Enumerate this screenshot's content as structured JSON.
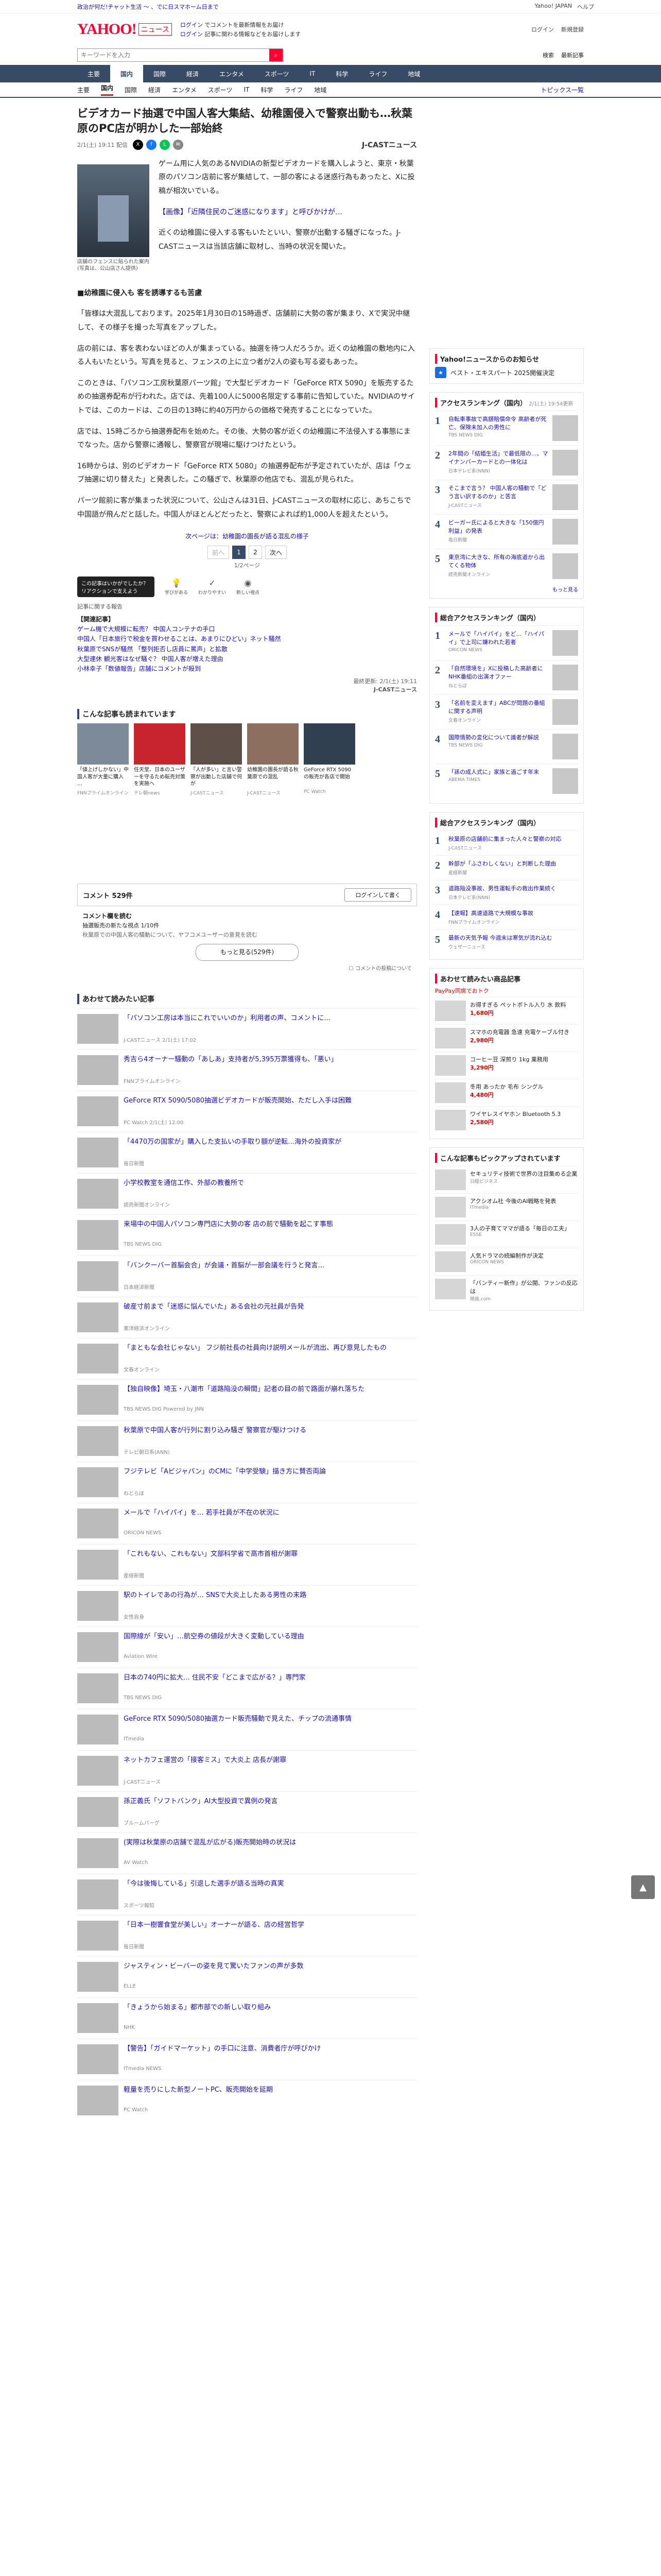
{
  "topbar": {
    "promo": "政治が何だ!チャット生活 ～ 、でに日スマホーム日まで",
    "links": [
      "Yahoo! JAPAN",
      "ヘルプ"
    ]
  },
  "header": {
    "logo": "YAHOO!",
    "logo_sub": "ニュース",
    "promo_1": "ログイン",
    "promo_1b": "でコメントを最新情報をお届け",
    "promo_2": "ログイン",
    "promo_2b": "記事に関わる情報などをお届けします",
    "right": [
      "ログイン",
      "新規登録"
    ]
  },
  "search": {
    "placeholder": "キーワードを入力",
    "right": [
      "検索",
      "最新記事"
    ]
  },
  "nav": [
    "主要",
    "国内",
    "国際",
    "経済",
    "エンタメ",
    "スポーツ",
    "IT",
    "科学",
    "ライフ",
    "地域"
  ],
  "subnav": [
    "主要",
    "国内",
    "国際",
    "経済",
    "エンタメ",
    "スポーツ",
    "IT",
    "科学",
    "ライフ",
    "地域"
  ],
  "subnav_topics": "トピックス一覧",
  "article": {
    "title": "ビデオカード抽選で中国人客大集結、幼稚園侵入で警察出動も…秋葉原のPC店が明かした一部始終",
    "date": "2/1(土) 19:11 配信",
    "source": "J-CASTニュース",
    "image_caption": "店舗のフェンスに貼られた案内(写真は、公山店さん提供)",
    "p1": "ゲーム用に人気のあるNVIDIAの新型ビデオカードを購入しようと、東京・秋葉原のパソコン店前に客が集結して、一部の客による迷惑行為もあったと、Xに投稿が相次いでいる。",
    "p2_link": "【画像】「近隣住民のご迷惑になります」と呼びかけが…",
    "p3": "近くの幼稚園に侵入する客もいたといい、警察が出動する騒ぎになった。J-CASTニュースは当該店舗に取材し、当時の状況を聞いた。",
    "sub1": "■幼稚園に侵入も 客を誘導するも苦慮",
    "p4": "「皆様は大混乱しております。2025年1月30日の15時過ぎ、店舗前に大勢の客が集まり、Xで実況中継して、その様子を撮った写真をアップした。",
    "p5": "店の前には、客を表わないほどの人が集まっている。抽選を待つ人だろうか。近くの幼稚園の敷地内に入る人もいたという。写真を見ると、フェンスの上に立つ者が2人の姿も写る姿もあった。",
    "p6": "このときは、「パソコン工房秋葉原パーツ館」で大型ビデオカード「GeForce RTX 5090」を販売するための抽選券配布が行われた。店では、先着100人に5000名限定する事前に告知していた。NVIDIAのサイトでは、このカードは、この日の13時に約40万円からの価格で発売することになっていた。",
    "p7": "店では、15時ごろから抽選券配布を始めた。その後、大勢の客が近くの幼稚園に不法侵入する事態にまでなった。店から警察に通報し、警察官が現場に駆けつけたという。",
    "p8": "16時からは、別のビデオカード「GeForce RTX 5080」の抽選券配布が予定されていたが、店は「ウェブ抽選に切り替えた」と発表した。この騒ぎで、秋葉原の他店でも、混乱が見られた。",
    "p9": "パーツ館前に客が集まった状況について、公山さんは31日、J-CASTニュースの取材に応じ、あちこちで中国語が飛んだと話した。中国人がほとんどだったと、警察によれば約1,000人を超えたという。",
    "continue": "次ページは：幼稚園の園長が語る混乱の様子"
  },
  "pager": {
    "prev": "前へ",
    "pages": [
      "1",
      "2"
    ],
    "next": "次へ",
    "count": "1/2ページ"
  },
  "reactions": {
    "prompt": "この記事はいかがでしたか？リアクションで支えよう",
    "buttons": [
      "学びがある",
      "わかりやすい",
      "新しい視点"
    ]
  },
  "related": {
    "label": "記事に関する報告",
    "heading": "【関連記事】",
    "items": [
      "ゲーム機で大規模に転売？ 中国人コンテナの手口",
      "中国人「日本旅行で税金を買わせることは、あまりにひどい」ネット騒然",
      "秋葉原でSNSが騒然 「整列拒否し店員に罵声」と拡散",
      "大型連休 観光客はなぜ騒ぐ？ 中国人客が増えた理由",
      "小林幸子「数値報告」店舗にコメントが殺到"
    ],
    "copyright": "最終更新: 2/1(土) 19:11",
    "copyright_source": "J-CASTニュース"
  },
  "reading_section": {
    "title": "こんな記事も読まれています",
    "items": [
      {
        "t": "「値上げしかない」中国人客が大量に購入 ...",
        "s": "FNNプライムオンライン"
      },
      {
        "t": "任天堂、日本のユーザーを守るため転売対策を実施へ",
        "s": "テレ朝news"
      },
      {
        "t": "「人が多い」と言い警察が出動した店舗で何が",
        "s": "J-CASTニュース"
      },
      {
        "t": "幼稚園の園長が語る秋葉原での混乱",
        "s": "J-CASTニュース"
      },
      {
        "t": "GeForce RTX 5090の販売が各店で開始",
        "s": "PC Watch"
      }
    ]
  },
  "comments": {
    "label": "コメント 529件",
    "write": "ログインして書く",
    "block_title": "コメント欄を読む",
    "block_sub": "抽選販売の新たな視点 1/10件",
    "hint": "秋葉原での中国人客の騒動について、ヤフコメユーザーの意見を読む",
    "more": "もっと見る(529件)",
    "rule": "コメントの投稿について"
  },
  "recommended": {
    "title": "あわせて読みたい記事",
    "items": [
      {
        "t": "「パソコン工房は本当にこれでいいのか」利用者の声、コメントに...",
        "s": "J-CASTニュース  2/1(土) 17:02"
      },
      {
        "t": "秀吉ら4オーナー騒動の「あしあ」支持者が5,395万票獲得も、「悪い」",
        "s": "FNNプライムオンライン"
      },
      {
        "t": "GeForce RTX 5090/5080抽選ビデオカードが販売開始、ただし入手は困難",
        "s": "PC Watch  2/1(土) 12:00"
      },
      {
        "t": "「4470万の国家が」購入した支払いの手取り額が逆転…海外の投資家が",
        "s": "毎日新聞"
      },
      {
        "t": "小学校教室を通信工作、外部の教養所で",
        "s": "読売新聞オンライン"
      },
      {
        "t": "来場中の中国人パソコン専門店に大勢の客 店の前で騒動を起こす事態",
        "s": "TBS NEWS DIG"
      },
      {
        "t": "「バンクーバー首脳会合」が会議・首脳が一部会議を行うと発言…",
        "s": "日本経済新聞"
      },
      {
        "t": "破産寸前まで「迷惑に悩んでいた」ある会社の元社員が告発",
        "s": "東洋経済オンライン"
      },
      {
        "t": "「まともな会社じゃない」 フジ前社長の社員向け説明メールが流出、再び意見したもの",
        "s": "文春オンライン"
      },
      {
        "t": "【独自映像】埼玉・八潮市「道路陥没の瞬間」記者の目の前で路面が崩れ落ちた",
        "s": "TBS NEWS DIG Powered by JNN"
      },
      {
        "t": "秋葉原で中国人客が行列に割り込み騒ぎ 警察官が駆けつける",
        "s": "テレビ朝日系(ANN)"
      },
      {
        "t": "フジテレビ「Aビジャパン」のCMに「中学受験」描き方に賛否両論",
        "s": "ねとらぼ"
      },
      {
        "t": "メールで「ハイパイ」を… 若手社員が不在の状況に",
        "s": "ORICON NEWS"
      },
      {
        "t": "「これもない、これもない」文部科学省で高市首相が謝罪",
        "s": "産経新聞"
      },
      {
        "t": "駅のトイレであの行為が… SNSで大炎上したある男性の末路",
        "s": "女性自身"
      },
      {
        "t": "国際線が「安い」…航空券の値段が大きく変動している理由",
        "s": "Aviation Wire"
      },
      {
        "t": "日本の740円に拡大… 住民不安「どこまで広がる？」専門家",
        "s": "TBS NEWS DIG"
      },
      {
        "t": "GeForce RTX 5090/5080抽選カード販売騒動で見えた、チップの流通事情",
        "s": "ITmedia"
      },
      {
        "t": "ネットカフェ運営の「接客ミス」で大炎上 店長が謝罪",
        "s": "J-CASTニュース"
      },
      {
        "t": "孫正義氏「ソフトバンク」AI大型投資で異例の発言",
        "s": "ブルームバーグ"
      },
      {
        "t": "(実際は秋葉原の店舗で混乱が広がる)販売開始時の状況は",
        "s": "AV Watch"
      },
      {
        "t": "「今は後悔している」引退した選手が語る当時の真実",
        "s": "スポーツ報知"
      },
      {
        "t": "「日本一樹響食堂が美しい」オーナーが語る、店の経営哲学",
        "s": "毎日新聞"
      },
      {
        "t": "ジャスティン・ビーバーの姿を見て驚いたファンの声が多数",
        "s": "ELLE"
      },
      {
        "t": "「きょうから始まる」都市部での新しい取り組み",
        "s": "NHK"
      },
      {
        "t": "【警告】「ガイドマーケット」の手口に注意、消費者庁が呼びかけ",
        "s": "ITmedia NEWS"
      },
      {
        "t": "軽量を売りにした新型ノートPC、販売開始を延期",
        "s": "PC Watch"
      }
    ]
  },
  "side": {
    "banner_title": "Yahoo!ニュースからのお知らせ",
    "banner_text": "ベスト・エキスパート 2025開催決定",
    "rank1_title": "アクセスランキング（国内）",
    "rank1_sub": "2/1(土) 19:54更新",
    "rank1": [
      {
        "n": "1",
        "t": "自転車事故で高額賠償命令 高齢者が死亡、保険未加入の男性に",
        "s": "TBS NEWS DIG"
      },
      {
        "t": "2年間の「結婚生活」で最低限の...、マイナンバーカードとの一体化は",
        "s": "日本テレビ系(NNN)",
        "n": "2"
      },
      {
        "n": "3",
        "t": "そこまで言う？ 中国人客の騒動で「どう言い訳するのか」と苦言",
        "s": "J-CASTニュース"
      },
      {
        "n": "4",
        "t": "ビーガー氏によると大きな「150億円利益」の発表",
        "s": "毎日新聞"
      },
      {
        "n": "5",
        "t": "東京湾に大きな、所有の海底道から出てくる物体",
        "s": "読売新聞オンライン"
      }
    ],
    "rank2_title": "総合アクセスランキング（国内）",
    "rank2": [
      {
        "n": "1",
        "t": "メールで「ハイパイ」をど…「ハイパイ」で上司に嫌われた若者",
        "s": "ORICON NEWS"
      },
      {
        "n": "2",
        "t": "「自然環境を」Xに投稿した高齢者にNHK番組の出演オファー",
        "s": "ねとらぼ"
      },
      {
        "n": "3",
        "t": "「名前を変えます」ABCが問題の番組に関する声明",
        "s": "文春オンライン"
      },
      {
        "n": "4",
        "t": "国際情勢の変化について識者が解説",
        "s": "TBS NEWS DIG"
      },
      {
        "n": "5",
        "t": "「孫の成人式に」家族と過ごす年末",
        "s": "ABEMA TIMES"
      }
    ],
    "rank3_title": "総合アクセスランキング（国内）",
    "rank3": [
      {
        "n": "1",
        "t": "秋葉原の店舗前に集まった人々と警察の対応",
        "s": "J-CASTニュース"
      },
      {
        "n": "2",
        "t": "幹部が「ふさわしくない」と判断した理由",
        "s": "産経新聞"
      },
      {
        "n": "3",
        "t": "道路陥没事故、男性運転手の救出作業続く",
        "s": "日本テレビ系(NNN)"
      },
      {
        "n": "4",
        "t": "【速報】高速道路で大規模な事故",
        "s": "FNNプライムオンライン"
      },
      {
        "n": "5",
        "t": "最新の天気予報 今週末は寒気が流れ込む",
        "s": "ウェザーニュース"
      }
    ],
    "ad_title": "あわせて読みたい商品記事",
    "ad_label": "PayPay同席でおトク",
    "ads": [
      {
        "t": "お得すぎる ペットボトル入り 水 飲料",
        "p": "1,680円"
      },
      {
        "t": "スマホの充電器 急速 充電ケーブル付き",
        "p": "2,980円"
      },
      {
        "t": "コーヒー豆 深煎り 1kg 業務用",
        "p": "3,290円"
      },
      {
        "t": "冬用 あったか 毛布 シングル",
        "p": "4,480円"
      },
      {
        "t": "ワイヤレスイヤホン Bluetooth 5.3",
        "p": "2,580円"
      }
    ],
    "pickup_title": "こんな記事もピックアップされています",
    "pickup": [
      {
        "t": "セキュリティ技術で世界の注目集める企業",
        "s": "日経ビジネス"
      },
      {
        "t": "アクシオム社 今後のAI戦略を発表",
        "s": "ITmedia"
      },
      {
        "t": "3人の子育てママが語る「毎日の工夫」",
        "s": "ESSE"
      },
      {
        "t": "人気ドラマの続編制作が決定",
        "s": "ORICON NEWS"
      },
      {
        "t": "「バンティー新作」が公開、ファンの反応は",
        "s": "映画.com"
      }
    ],
    "more": "もっと見る"
  },
  "pagetop": "▲"
}
